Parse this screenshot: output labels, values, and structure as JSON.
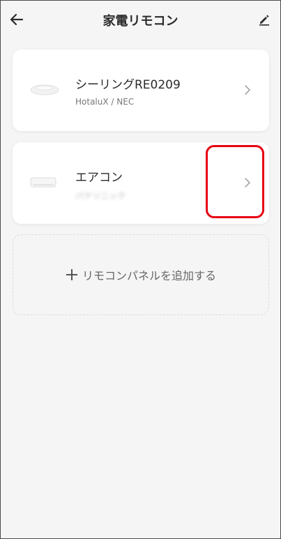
{
  "header": {
    "title": "家電リモコン",
    "back_icon": "arrow-left-icon",
    "edit_icon": "pencil-icon"
  },
  "devices": [
    {
      "name": "シーリングRE0209",
      "subtitle": "HotaluX / NEC",
      "icon": "ceiling-light-icon"
    },
    {
      "name": "エアコン",
      "subtitle": "パナソニック",
      "subtitle_blurred": true,
      "icon": "air-conditioner-icon"
    }
  ],
  "add_panel": {
    "label": "リモコンパネルを追加する",
    "icon": "plus-icon"
  },
  "colors": {
    "background": "#f5f5f5",
    "card": "#ffffff",
    "highlight": "#e60012"
  }
}
